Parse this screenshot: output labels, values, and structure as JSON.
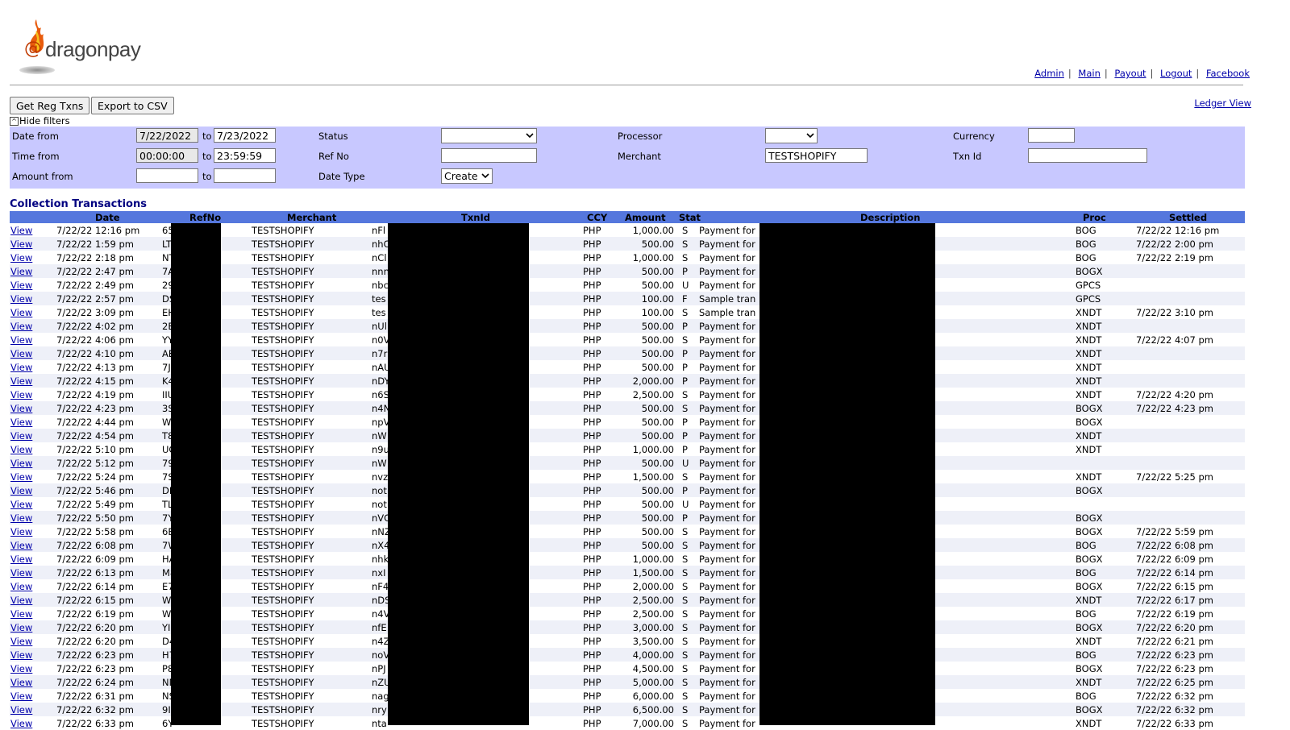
{
  "brand": {
    "at": "@",
    "name": "dragonpay"
  },
  "nav": [
    {
      "label": "Admin"
    },
    {
      "label": "Main"
    },
    {
      "label": "Payout"
    },
    {
      "label": "Logout"
    },
    {
      "label": "Facebook"
    }
  ],
  "buttons": {
    "get_reg": "Get Reg Txns",
    "export": "Export to CSV"
  },
  "ledger_view": "Ledger View",
  "hide_filters": "Hide filters",
  "filters": {
    "date_from_label": "Date from",
    "date_from": "7/22/2022",
    "to1": "to",
    "date_to": "7/23/2022",
    "time_from_label": "Time from",
    "time_from": "00:00:00",
    "to2": "to",
    "time_to": "23:59:59",
    "amount_from_label": "Amount from",
    "to3": "to",
    "status_label": "Status",
    "status_value": "",
    "refno_label": "Ref No",
    "datetype_label": "Date Type",
    "datetype_value": "Create",
    "processor_label": "Processor",
    "processor_value": "",
    "merchant_label": "Merchant",
    "merchant_value": "TESTSHOPIFY",
    "currency_label": "Currency",
    "txnid_label": "Txn Id"
  },
  "section_title": "Collection Transactions",
  "columns": {
    "date": "Date",
    "refno": "RefNo",
    "merchant": "Merchant",
    "txnid": "TxnId",
    "ccy": "CCY",
    "amount": "Amount",
    "stat": "Stat",
    "description": "Description",
    "proc": "Proc",
    "settled": "Settled"
  },
  "rows": [
    [
      "View",
      "7/22/22 12:16 pm",
      "65",
      "TESTSHOPIFY",
      "nFl",
      "PHP",
      "1,000.00",
      "S",
      "Payment for",
      "BOG",
      "7/22/22 12:16 pm"
    ],
    [
      "View",
      "7/22/22 1:59 pm",
      "LT",
      "TESTSHOPIFY",
      "nhC",
      "PHP",
      "500.00",
      "S",
      "Payment for",
      "BOG",
      "7/22/22 2:00 pm"
    ],
    [
      "View",
      "7/22/22 2:18 pm",
      "NT",
      "TESTSHOPIFY",
      "nCl",
      "PHP",
      "1,000.00",
      "S",
      "Payment for",
      "BOG",
      "7/22/22 2:19 pm"
    ],
    [
      "View",
      "7/22/22 2:47 pm",
      "7A",
      "TESTSHOPIFY",
      "nnn",
      "PHP",
      "500.00",
      "P",
      "Payment for",
      "BOGX",
      ""
    ],
    [
      "View",
      "7/22/22 2:49 pm",
      "29",
      "TESTSHOPIFY",
      "nbc",
      "PHP",
      "500.00",
      "U",
      "Payment for",
      "GPCS",
      ""
    ],
    [
      "View",
      "7/22/22 2:57 pm",
      "DS",
      "TESTSHOPIFY",
      "tes",
      "PHP",
      "100.00",
      "F",
      "Sample tran",
      "GPCS",
      ""
    ],
    [
      "View",
      "7/22/22 3:09 pm",
      "EH",
      "TESTSHOPIFY",
      "tes",
      "PHP",
      "100.00",
      "S",
      "Sample tran",
      "XNDT",
      "7/22/22 3:10 pm"
    ],
    [
      "View",
      "7/22/22 4:02 pm",
      "2E",
      "TESTSHOPIFY",
      "nUl",
      "PHP",
      "500.00",
      "P",
      "Payment for",
      "XNDT",
      ""
    ],
    [
      "View",
      "7/22/22 4:06 pm",
      "YY",
      "TESTSHOPIFY",
      "n0V",
      "PHP",
      "500.00",
      "S",
      "Payment for",
      "XNDT",
      "7/22/22 4:07 pm"
    ],
    [
      "View",
      "7/22/22 4:10 pm",
      "AE",
      "TESTSHOPIFY",
      "n7r",
      "PHP",
      "500.00",
      "P",
      "Payment for",
      "XNDT",
      ""
    ],
    [
      "View",
      "7/22/22 4:13 pm",
      "7J",
      "TESTSHOPIFY",
      "nAU",
      "PHP",
      "500.00",
      "P",
      "Payment for",
      "XNDT",
      ""
    ],
    [
      "View",
      "7/22/22 4:15 pm",
      "K4",
      "TESTSHOPIFY",
      "nDY",
      "PHP",
      "2,000.00",
      "P",
      "Payment for",
      "XNDT",
      ""
    ],
    [
      "View",
      "7/22/22 4:19 pm",
      "IIU",
      "TESTSHOPIFY",
      "n6S",
      "PHP",
      "2,500.00",
      "S",
      "Payment for",
      "XNDT",
      "7/22/22 4:20 pm"
    ],
    [
      "View",
      "7/22/22 4:23 pm",
      "3S",
      "TESTSHOPIFY",
      "n4N",
      "PHP",
      "500.00",
      "S",
      "Payment for",
      "BOGX",
      "7/22/22 4:23 pm"
    ],
    [
      "View",
      "7/22/22 4:44 pm",
      "W",
      "TESTSHOPIFY",
      "npV",
      "PHP",
      "500.00",
      "P",
      "Payment for",
      "BOGX",
      ""
    ],
    [
      "View",
      "7/22/22 4:54 pm",
      "T8",
      "TESTSHOPIFY",
      "nW",
      "PHP",
      "500.00",
      "P",
      "Payment for",
      "XNDT",
      ""
    ],
    [
      "View",
      "7/22/22 5:10 pm",
      "UG",
      "TESTSHOPIFY",
      "n9u",
      "PHP",
      "1,000.00",
      "P",
      "Payment for",
      "XNDT",
      ""
    ],
    [
      "View",
      "7/22/22 5:12 pm",
      "79",
      "TESTSHOPIFY",
      "nW",
      "PHP",
      "500.00",
      "U",
      "Payment for",
      "",
      ""
    ],
    [
      "View",
      "7/22/22 5:24 pm",
      "7S",
      "TESTSHOPIFY",
      "nvz",
      "PHP",
      "1,500.00",
      "S",
      "Payment for",
      "XNDT",
      "7/22/22 5:25 pm"
    ],
    [
      "View",
      "7/22/22 5:46 pm",
      "DH",
      "TESTSHOPIFY",
      "not",
      "PHP",
      "500.00",
      "P",
      "Payment for",
      "BOGX",
      ""
    ],
    [
      "View",
      "7/22/22 5:49 pm",
      "TL",
      "TESTSHOPIFY",
      "not",
      "PHP",
      "500.00",
      "U",
      "Payment for",
      "",
      ""
    ],
    [
      "View",
      "7/22/22 5:50 pm",
      "7Y",
      "TESTSHOPIFY",
      "nVC",
      "PHP",
      "500.00",
      "P",
      "Payment for",
      "BOGX",
      ""
    ],
    [
      "View",
      "7/22/22 5:58 pm",
      "6B",
      "TESTSHOPIFY",
      "nNZ",
      "PHP",
      "500.00",
      "S",
      "Payment for",
      "BOGX",
      "7/22/22 5:59 pm"
    ],
    [
      "View",
      "7/22/22 6:08 pm",
      "7W",
      "TESTSHOPIFY",
      "nX4",
      "PHP",
      "500.00",
      "S",
      "Payment for",
      "BOG",
      "7/22/22 6:08 pm"
    ],
    [
      "View",
      "7/22/22 6:09 pm",
      "HA",
      "TESTSHOPIFY",
      "nhk",
      "PHP",
      "1,000.00",
      "S",
      "Payment for",
      "BOGX",
      "7/22/22 6:09 pm"
    ],
    [
      "View",
      "7/22/22 6:13 pm",
      "M8",
      "TESTSHOPIFY",
      "nxI",
      "PHP",
      "1,500.00",
      "S",
      "Payment for",
      "BOG",
      "7/22/22 6:14 pm"
    ],
    [
      "View",
      "7/22/22 6:14 pm",
      "E7",
      "TESTSHOPIFY",
      "nF4",
      "PHP",
      "2,000.00",
      "S",
      "Payment for",
      "BOGX",
      "7/22/22 6:15 pm"
    ],
    [
      "View",
      "7/22/22 6:15 pm",
      "W3",
      "TESTSHOPIFY",
      "nDS",
      "PHP",
      "2,500.00",
      "S",
      "Payment for",
      "XNDT",
      "7/22/22 6:17 pm"
    ],
    [
      "View",
      "7/22/22 6:19 pm",
      "WB",
      "TESTSHOPIFY",
      "n4V",
      "PHP",
      "2,500.00",
      "S",
      "Payment for",
      "BOG",
      "7/22/22 6:19 pm"
    ],
    [
      "View",
      "7/22/22 6:20 pm",
      "YI",
      "TESTSHOPIFY",
      "nfE",
      "PHP",
      "3,000.00",
      "S",
      "Payment for",
      "BOGX",
      "7/22/22 6:20 pm"
    ],
    [
      "View",
      "7/22/22 6:20 pm",
      "D4",
      "TESTSHOPIFY",
      "n4Z",
      "PHP",
      "3,500.00",
      "S",
      "Payment for",
      "XNDT",
      "7/22/22 6:21 pm"
    ],
    [
      "View",
      "7/22/22 6:23 pm",
      "H7",
      "TESTSHOPIFY",
      "noV",
      "PHP",
      "4,000.00",
      "S",
      "Payment for",
      "BOG",
      "7/22/22 6:23 pm"
    ],
    [
      "View",
      "7/22/22 6:23 pm",
      "P8",
      "TESTSHOPIFY",
      "nPJ",
      "PHP",
      "4,500.00",
      "S",
      "Payment for",
      "BOGX",
      "7/22/22 6:23 pm"
    ],
    [
      "View",
      "7/22/22 6:24 pm",
      "NN",
      "TESTSHOPIFY",
      "nZU",
      "PHP",
      "5,000.00",
      "S",
      "Payment for",
      "XNDT",
      "7/22/22 6:25 pm"
    ],
    [
      "View",
      "7/22/22 6:31 pm",
      "NS",
      "TESTSHOPIFY",
      "nag",
      "PHP",
      "6,000.00",
      "S",
      "Payment for",
      "BOG",
      "7/22/22 6:32 pm"
    ],
    [
      "View",
      "7/22/22 6:32 pm",
      "9I",
      "TESTSHOPIFY",
      "nry",
      "PHP",
      "6,500.00",
      "S",
      "Payment for",
      "BOGX",
      "7/22/22 6:32 pm"
    ],
    [
      "View",
      "7/22/22 6:33 pm",
      "6Y",
      "TESTSHOPIFY",
      "nta",
      "PHP",
      "7,000.00",
      "S",
      "Payment for",
      "XNDT",
      "7/22/22 6:33 pm"
    ]
  ]
}
